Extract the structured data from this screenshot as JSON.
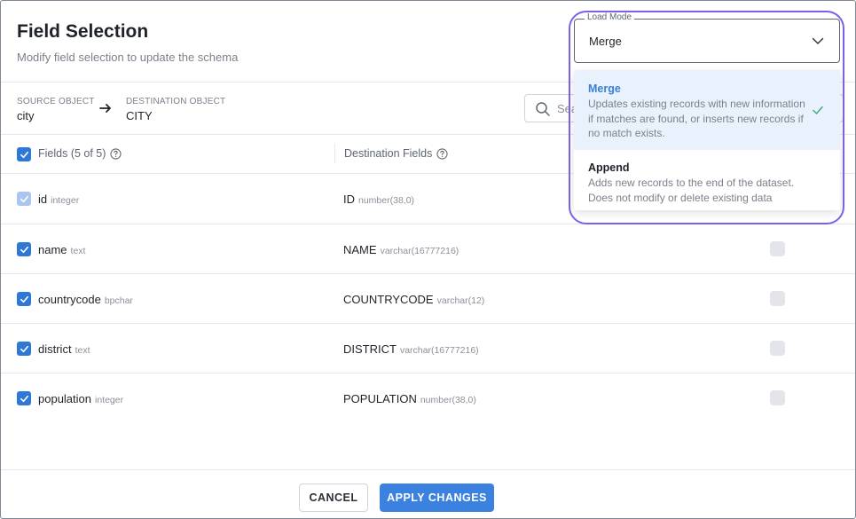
{
  "header": {
    "title": "Field Selection",
    "subtitle": "Modify field selection to update the schema"
  },
  "objects": {
    "source_label": "SOURCE OBJECT",
    "source_value": "city",
    "destination_label": "DESTINATION OBJECT",
    "destination_value": "CITY"
  },
  "search": {
    "placeholder": "Search"
  },
  "table": {
    "fields_header": "Fields (5 of 5)",
    "destination_header": "Destination Fields",
    "rows": [
      {
        "name": "id",
        "type": "integer",
        "dest_name": "ID",
        "dest_type": "number(38,0)",
        "checked": true,
        "disabled": true
      },
      {
        "name": "name",
        "type": "text",
        "dest_name": "NAME",
        "dest_type": "varchar(16777216)",
        "checked": true,
        "disabled": false
      },
      {
        "name": "countrycode",
        "type": "bpchar",
        "dest_name": "COUNTRYCODE",
        "dest_type": "varchar(12)",
        "checked": true,
        "disabled": false
      },
      {
        "name": "district",
        "type": "text",
        "dest_name": "DISTRICT",
        "dest_type": "varchar(16777216)",
        "checked": true,
        "disabled": false
      },
      {
        "name": "population",
        "type": "integer",
        "dest_name": "POPULATION",
        "dest_type": "number(38,0)",
        "checked": true,
        "disabled": false
      }
    ]
  },
  "load_mode": {
    "label": "Load Mode",
    "value": "Merge",
    "options": [
      {
        "title": "Merge",
        "description": "Updates existing records with new information if matches are found, or inserts new records if no match exists.",
        "selected": true
      },
      {
        "title": "Append",
        "description": "Adds new records to the end of the dataset. Does not modify or delete existing data",
        "selected": false
      }
    ]
  },
  "footer": {
    "cancel_label": "CANCEL",
    "apply_label": "APPLY CHANGES"
  },
  "colors": {
    "primary": "#3b82e0",
    "highlight_border": "#7b61e8",
    "selected_option_bg": "#e9f2fc"
  }
}
